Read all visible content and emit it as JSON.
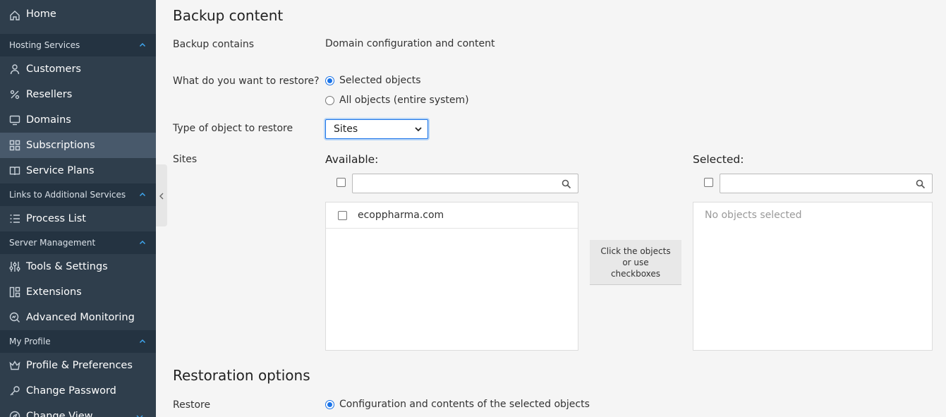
{
  "sidebar": {
    "home": "Home",
    "sections": [
      {
        "title": "Hosting Services",
        "items": [
          "Customers",
          "Resellers",
          "Domains",
          "Subscriptions",
          "Service Plans"
        ]
      },
      {
        "title": "Links to Additional Services",
        "items": [
          "Process List"
        ]
      },
      {
        "title": "Server Management",
        "items": [
          "Tools & Settings",
          "Extensions",
          "Advanced Monitoring"
        ]
      },
      {
        "title": "My Profile",
        "items": [
          "Profile & Preferences",
          "Change Password",
          "Change View"
        ]
      }
    ],
    "active_item": "Subscriptions"
  },
  "backup_content": {
    "heading": "Backup content",
    "contains_label": "Backup contains",
    "contains_value": "Domain configuration and content",
    "restore_what_label": "What do you want to restore?",
    "option_selected": "Selected objects",
    "option_all": "All objects (entire system)",
    "type_label": "Type of object to restore",
    "type_value": "Sites",
    "sites_label": "Sites",
    "available_title": "Available:",
    "selected_title": "Selected:",
    "available_items": [
      "ecoppharma.com"
    ],
    "no_selection": "No objects selected",
    "move_hint": "Click the objects or use checkboxes"
  },
  "restoration": {
    "heading": "Restoration options",
    "restore_label": "Restore",
    "restore_option": "Configuration and contents of the selected objects"
  },
  "colors": {
    "sidebar_bg": "#2f3e4c",
    "section_bg": "#243341",
    "active_bg": "#48596b",
    "accent": "#1a73e8"
  }
}
